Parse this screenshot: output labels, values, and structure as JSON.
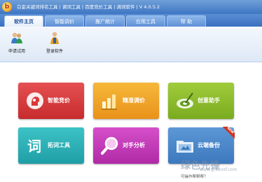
{
  "titlebar": {
    "title": "白金关键词排名工具 | 调词工具 | 百度竞价工具 | 调词软件 |  V 4.0.5.2"
  },
  "tabs": [
    {
      "label": "软件主页"
    },
    {
      "label": "智能调价"
    },
    {
      "label": "推广统计"
    },
    {
      "label": "应用工具"
    },
    {
      "label": "帮  助"
    }
  ],
  "toolbar": [
    {
      "label": "申请试用",
      "icon": "users-icon"
    },
    {
      "label": "登录软件",
      "icon": "user-login-icon"
    }
  ],
  "tiles": [
    {
      "label": "智能竞价",
      "color": "#d9393b",
      "icon": "bid-head-icon"
    },
    {
      "label": "精准调价",
      "color": "#efa31d",
      "icon": "bar-chart-icon"
    },
    {
      "label": "创意助手",
      "color": "#8cbc2a",
      "icon": "target-disc-icon"
    },
    {
      "label": "拓词工具",
      "color": "#2ab3b8",
      "icon": "word-expand-icon"
    },
    {
      "label": "对手分析",
      "color": "#c437b8",
      "icon": "magnifier-icon"
    },
    {
      "label": "云端备份",
      "color": "#4a87c8",
      "icon": "folder-icon",
      "badge": "NEW"
    }
  ],
  "watermark": {
    "text": "绿色先锋",
    "url": "www.greenxf.com"
  },
  "help_text": "可操作帮帮帮？"
}
